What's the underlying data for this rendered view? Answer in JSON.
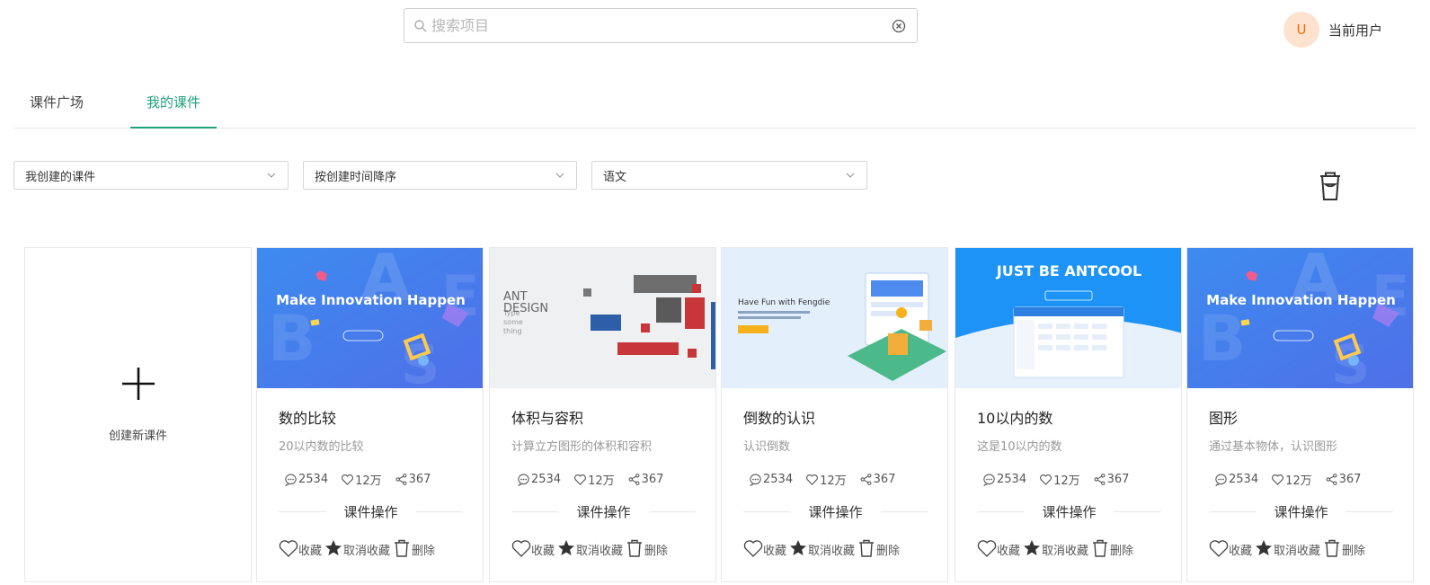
{
  "search": {
    "placeholder": "搜索项目"
  },
  "user": {
    "avatar_letter": "U",
    "name": "当前用户"
  },
  "tabs": [
    {
      "label": "课件广场",
      "active": false
    },
    {
      "label": "我的课件",
      "active": true
    }
  ],
  "filters": [
    {
      "value": "我创建的课件"
    },
    {
      "value": "按创建时间降序"
    },
    {
      "value": "语文"
    }
  ],
  "create_label": "创建新课件",
  "ops_title": "课件操作",
  "actions": {
    "favorite": "收藏",
    "unfavorite": "取消收藏",
    "delete": "删除"
  },
  "accent_color": "#1ea27a",
  "cards": [
    {
      "title": "数的比较",
      "desc": "20以内数的比较",
      "comments": "2534",
      "likes": "12万",
      "shares": "367",
      "cover": {
        "type": "innovation",
        "headline": "Make Innovation Happen"
      }
    },
    {
      "title": "体积与容积",
      "desc": "计算立方图形的体积和容积",
      "comments": "2534",
      "likes": "12万",
      "shares": "367",
      "cover": {
        "type": "antdesign",
        "headline": "ANT DESIGN"
      }
    },
    {
      "title": "倒数的认识",
      "desc": "认识倒数",
      "comments": "2534",
      "likes": "12万",
      "shares": "367",
      "cover": {
        "type": "fengdie",
        "headline": "Have Fun with Fengdie"
      }
    },
    {
      "title": "10以内的数",
      "desc": "这是10以内的数",
      "comments": "2534",
      "likes": "12万",
      "shares": "367",
      "cover": {
        "type": "antcool",
        "headline": "JUST BE ANTCOOL"
      }
    },
    {
      "title": "图形",
      "desc": "通过基本物体，认识图形",
      "comments": "2534",
      "likes": "12万",
      "shares": "367",
      "cover": {
        "type": "innovation",
        "headline": "Make Innovation Happen"
      }
    }
  ]
}
